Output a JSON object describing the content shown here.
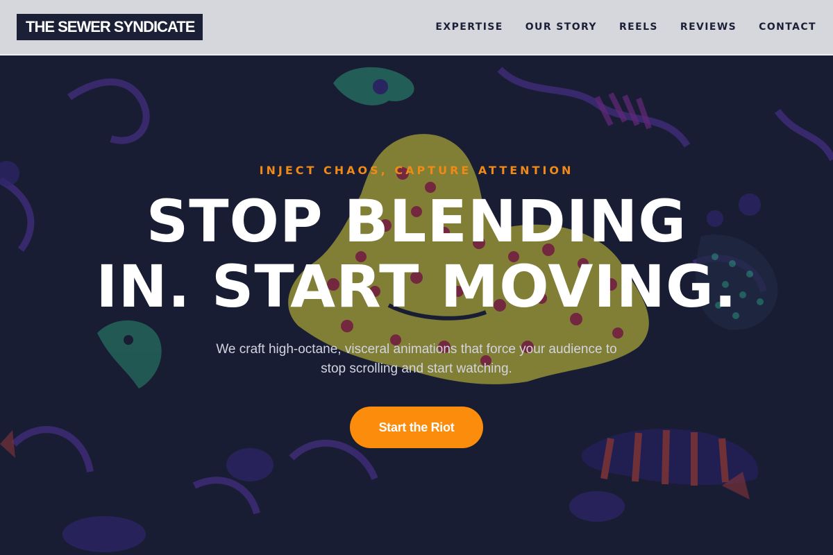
{
  "nav": {
    "logo": "THE SEWER SYNDICATE",
    "links": [
      "EXPERTISE",
      "OUR STORY",
      "REELS",
      "REVIEWS",
      "CONTACT"
    ]
  },
  "hero": {
    "tagline": "INJECT CHAOS, CAPTURE ATTENTION",
    "headline_line1": "STOP BLENDING",
    "headline_line2": "IN. START MOVING.",
    "subtext": "We craft high-octane, visceral animations that force your audience to stop scrolling and start watching.",
    "cta_label": "Start the Riot"
  },
  "colors": {
    "nav_bg": "#d6d7dc",
    "logo_bg": "#1c2036",
    "hero_bg": "#1b1f36",
    "accent": "#fb8c0c",
    "tagline": "#f08a16",
    "text": "#ffffff"
  }
}
